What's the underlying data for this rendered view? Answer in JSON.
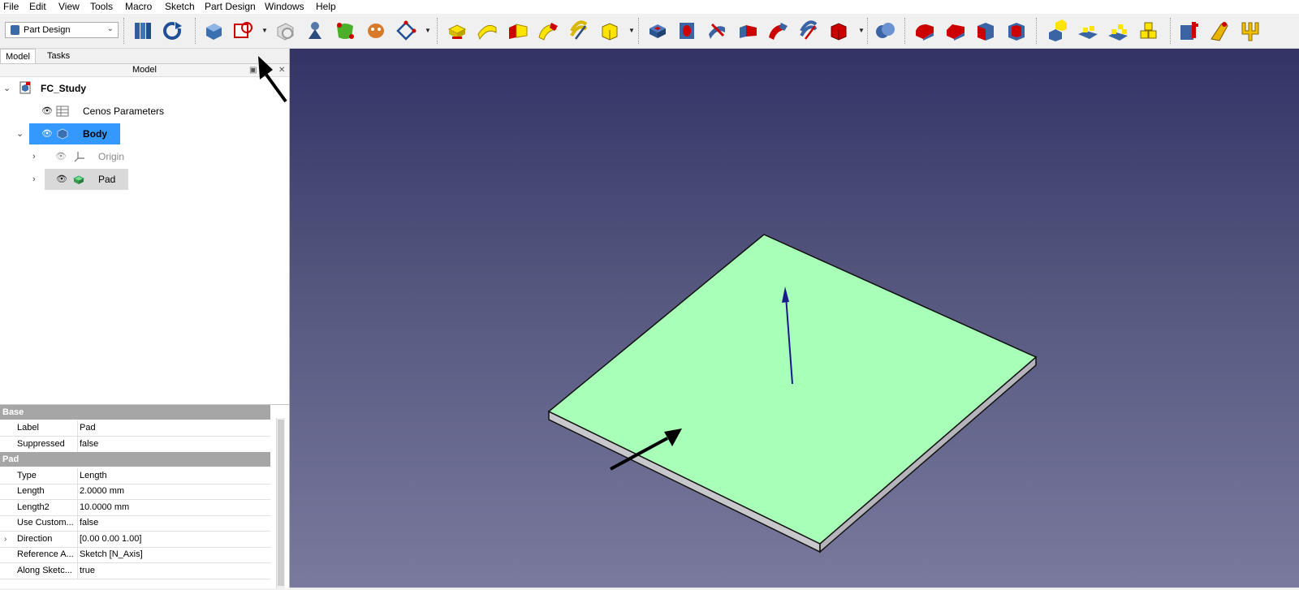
{
  "menu": [
    "File",
    "Edit",
    "View",
    "Tools",
    "Macro",
    "Sketch",
    "Part Design",
    "Windows",
    "Help"
  ],
  "workbench": {
    "selected": "Part Design"
  },
  "panel": {
    "tabs": [
      "Model",
      "Tasks"
    ],
    "title": "Model"
  },
  "tree": {
    "doc": "FC_Study",
    "spreadsheet": "Cenos Parameters",
    "body": "Body",
    "origin": "Origin",
    "pad": "Pad"
  },
  "properties": {
    "groups": [
      {
        "name": "Base",
        "rows": [
          {
            "k": "Label",
            "v": "Pad"
          },
          {
            "k": "Suppressed",
            "v": "false"
          }
        ]
      },
      {
        "name": "Pad",
        "rows": [
          {
            "k": "Type",
            "v": "Length"
          },
          {
            "k": "Length",
            "v": "2.0000 mm"
          },
          {
            "k": "Length2",
            "v": "10.0000 mm"
          },
          {
            "k": "Use Custom...",
            "v": "false"
          },
          {
            "k": "Direction",
            "v": "[0.00 0.00 1.00]"
          },
          {
            "k": "Reference A...",
            "v": "Sketch [N_Axis]"
          },
          {
            "k": "Along Sketc...",
            "v": "true"
          }
        ]
      }
    ]
  },
  "colors": {
    "face": "#a8ffb8",
    "side": "#c8c8cc",
    "selection": "#3399ff",
    "arrow_normal": "#1a1a8c",
    "viewport_top": "#333366",
    "viewport_bottom": "#7a7a9e"
  },
  "icons": [
    "create-body-icon",
    "create-sketch-icon",
    "validate-sketch-icon",
    "attach-icon",
    "clone-icon",
    "subshapebinder-icon",
    "datum-icon",
    "pad-icon",
    "revolution-icon",
    "loft-icon",
    "pipe-icon",
    "helix-icon",
    "additive-primitive-icon",
    "pocket-icon",
    "hole-icon",
    "groove-icon",
    "subtractive-loft-icon",
    "subtractive-pipe-icon",
    "subtractive-helix-icon",
    "subtractive-primitive-icon",
    "boolean-icon",
    "fillet-icon",
    "chamfer-icon",
    "draft-icon",
    "thickness-icon",
    "mirrored-icon",
    "linear-pattern-icon",
    "polar-pattern-icon",
    "multitransform-icon",
    "sprocket-icon",
    "involute-gear-icon",
    "shaft-wizard-icon"
  ]
}
